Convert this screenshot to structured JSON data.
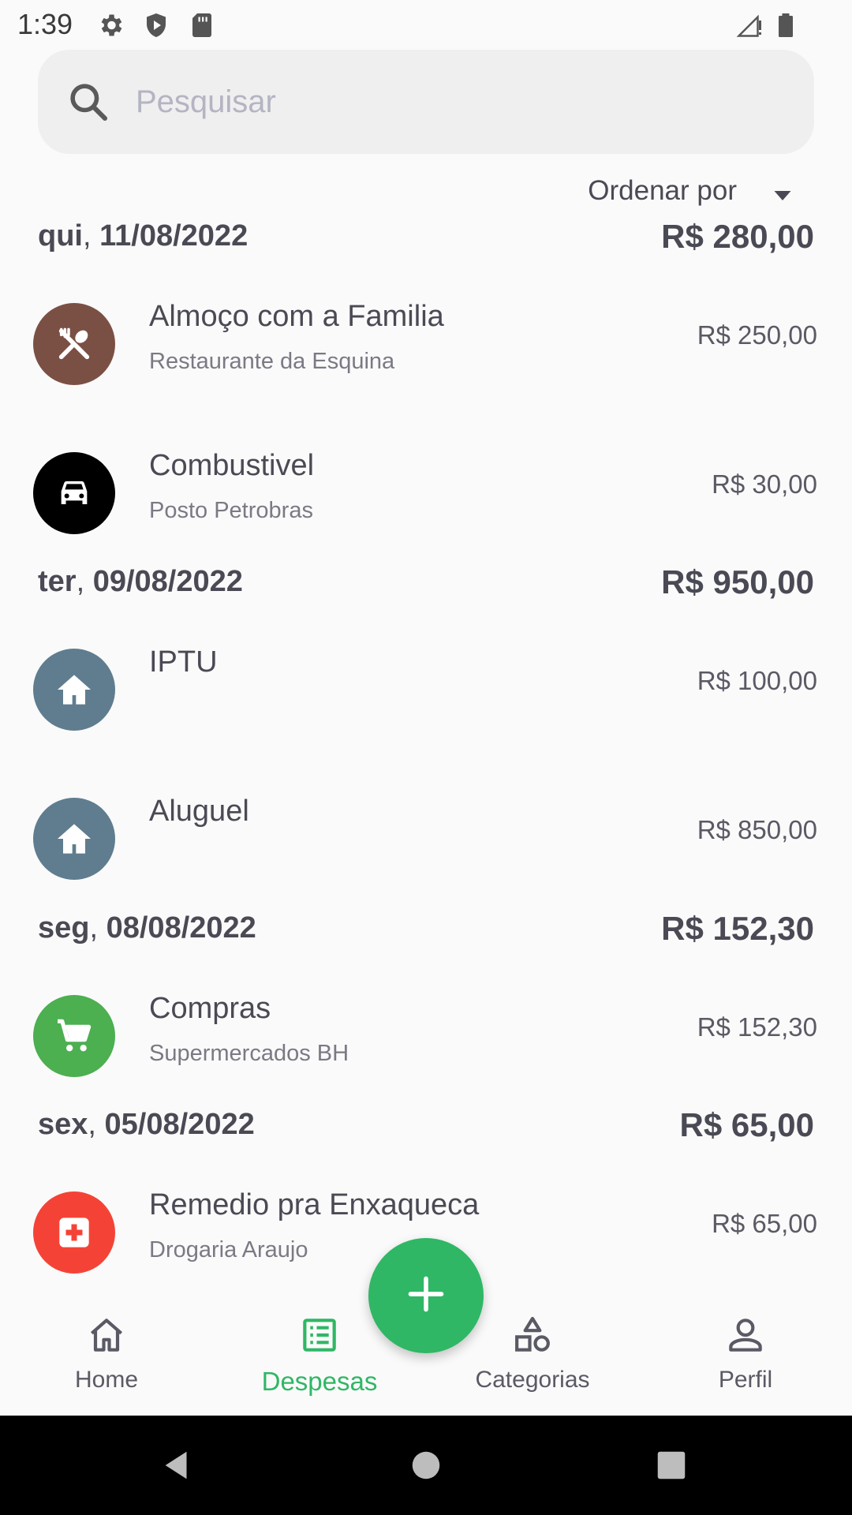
{
  "status_bar": {
    "time": "1:39",
    "icons": [
      "gear-icon",
      "shield-icon",
      "sd-card-icon",
      "signal-icon",
      "battery-icon"
    ]
  },
  "search": {
    "placeholder": "Pesquisar"
  },
  "sort": {
    "label": "Ordenar por"
  },
  "groups": [
    {
      "weekday": "qui",
      "date": "11/08/2022",
      "total": "R$ 280,00",
      "items": [
        {
          "title": "Almoço com a Familia",
          "subtitle": "Restaurante da Esquina",
          "value": "R$ 250,00",
          "icon": "restaurant-icon",
          "color": "#7b5044"
        },
        {
          "title": "Combustivel",
          "subtitle": "Posto Petrobras",
          "value": "R$ 30,00",
          "icon": "car-icon",
          "color": "#000000"
        }
      ]
    },
    {
      "weekday": "ter",
      "date": "09/08/2022",
      "total": "R$ 950,00",
      "items": [
        {
          "title": "IPTU",
          "subtitle": "",
          "value": "R$ 100,00",
          "icon": "house-icon",
          "color": "#5f7d8f"
        },
        {
          "title": "Aluguel",
          "subtitle": "",
          "value": "R$ 850,00",
          "icon": "house-icon",
          "color": "#5f7d8f"
        }
      ]
    },
    {
      "weekday": "seg",
      "date": "08/08/2022",
      "total": "R$ 152,30",
      "items": [
        {
          "title": "Compras",
          "subtitle": "Supermercados BH",
          "value": "R$ 152,30",
          "icon": "cart-icon",
          "color": "#4caf50"
        }
      ]
    },
    {
      "weekday": "sex",
      "date": "05/08/2022",
      "total": "R$ 65,00",
      "items": [
        {
          "title": "Remedio pra Enxaqueca",
          "subtitle": "Drogaria Araujo",
          "value": "R$ 65,00",
          "icon": "medical-icon",
          "color": "#f44336"
        }
      ]
    }
  ],
  "nav": {
    "home": "Home",
    "despesas": "Despesas",
    "categorias": "Categorias",
    "perfil": "Perfil",
    "active": "despesas"
  },
  "colors": {
    "accent": "#2fb765",
    "text": "#4a4a55"
  }
}
